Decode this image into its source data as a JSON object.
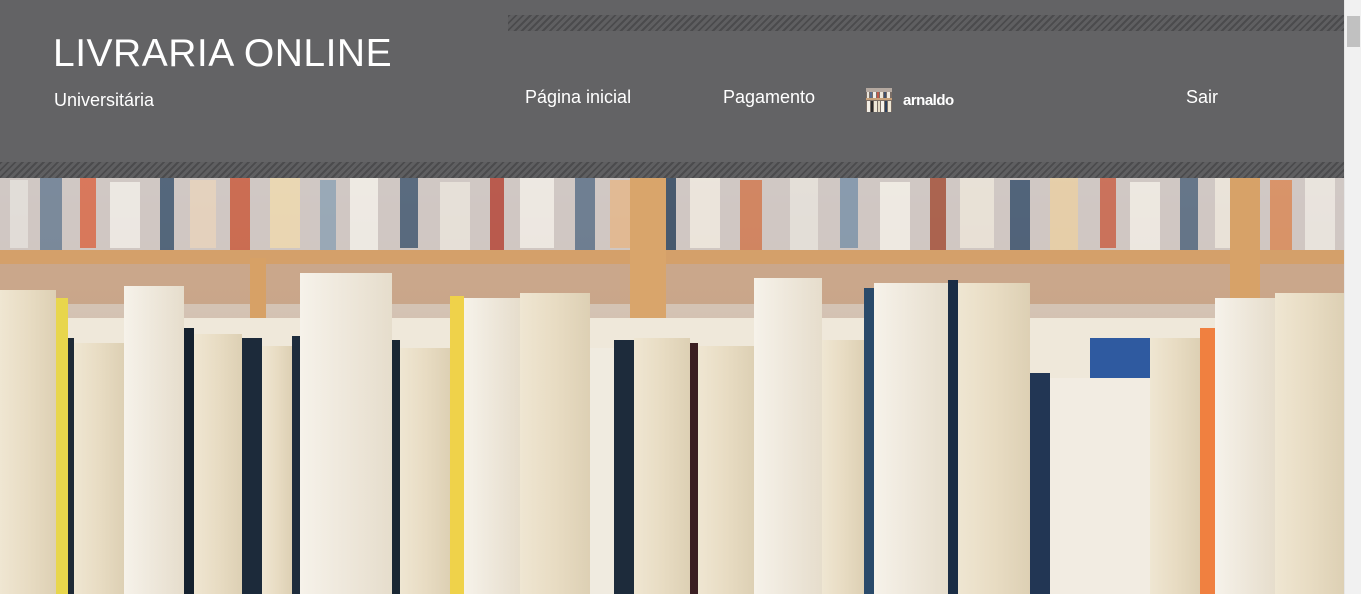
{
  "header": {
    "title": "LIVRARIA ONLINE",
    "subtitle": "Universitária"
  },
  "nav": {
    "home_label": "Página inicial",
    "payment_label": "Pagamento",
    "user_name": "arnaldo",
    "logout_label": "Sair"
  },
  "icons": {
    "user_avatar": "bookshelf-avatar-icon"
  },
  "hero": {
    "image": "bookshelf-photo"
  },
  "colors": {
    "header_bg": "#636365",
    "stripe": "#4b4b4d",
    "text": "#ffffff",
    "scrollbar_track": "#f1f1f1",
    "scrollbar_thumb": "#c1c1c1"
  }
}
